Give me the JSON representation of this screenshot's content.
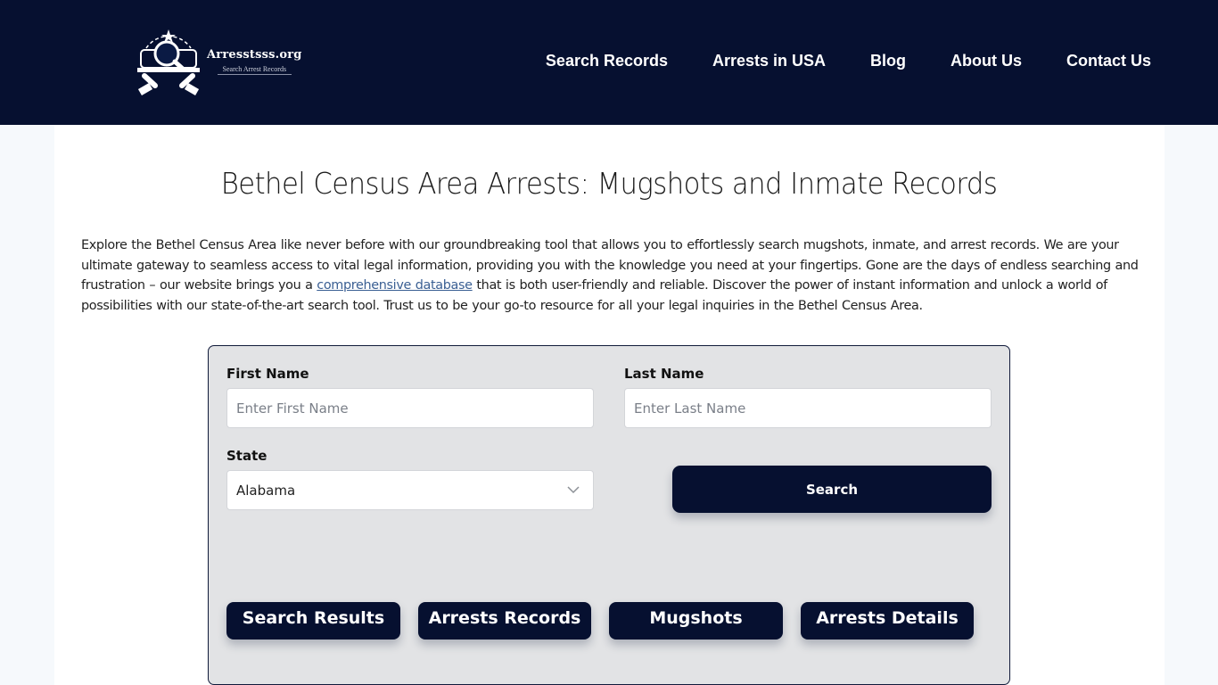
{
  "header": {
    "logo": {
      "title": "Arresstsss.org",
      "subtitle": "Search Arrest Records",
      "emblem_icon": "magnifier-badge-logo-icon"
    },
    "nav": [
      {
        "label": "Search Records"
      },
      {
        "label": "Arrests in USA"
      },
      {
        "label": "Blog"
      },
      {
        "label": "About Us"
      },
      {
        "label": "Contact Us"
      }
    ]
  },
  "page": {
    "title": "Bethel Census Area Arrests: Mugshots and Inmate Records",
    "intro_before_link": "Explore the Bethel Census Area like never before with our groundbreaking tool that allows you to effortlessly search mugshots, inmate, and arrest records. We are your ultimate gateway to seamless access to vital legal information, providing you with the knowledge you need at your fingertips. Gone are the days of endless searching and frustration – our website brings you a ",
    "intro_link": "comprehensive database",
    "intro_after_link": " that is both user-friendly and reliable. Discover the power of instant information and unlock a world of possibilities with our state-of-the-art search tool. Trust us to be your go-to resource for all your legal inquiries in the Bethel Census Area."
  },
  "form": {
    "first_name": {
      "label": "First Name",
      "placeholder": "Enter First Name",
      "value": ""
    },
    "last_name": {
      "label": "Last Name",
      "placeholder": "Enter Last Name",
      "value": ""
    },
    "state": {
      "label": "State",
      "selected": "Alabama"
    },
    "search_button": "Search",
    "tabs": [
      {
        "label": "Search Results"
      },
      {
        "label": "Arrests Records"
      },
      {
        "label": "Mugshots"
      },
      {
        "label": "Arrests Details"
      }
    ]
  },
  "colors": {
    "brand_navy": "#061030",
    "link": "#3a5f93",
    "form_bg": "#e2e3e5"
  }
}
